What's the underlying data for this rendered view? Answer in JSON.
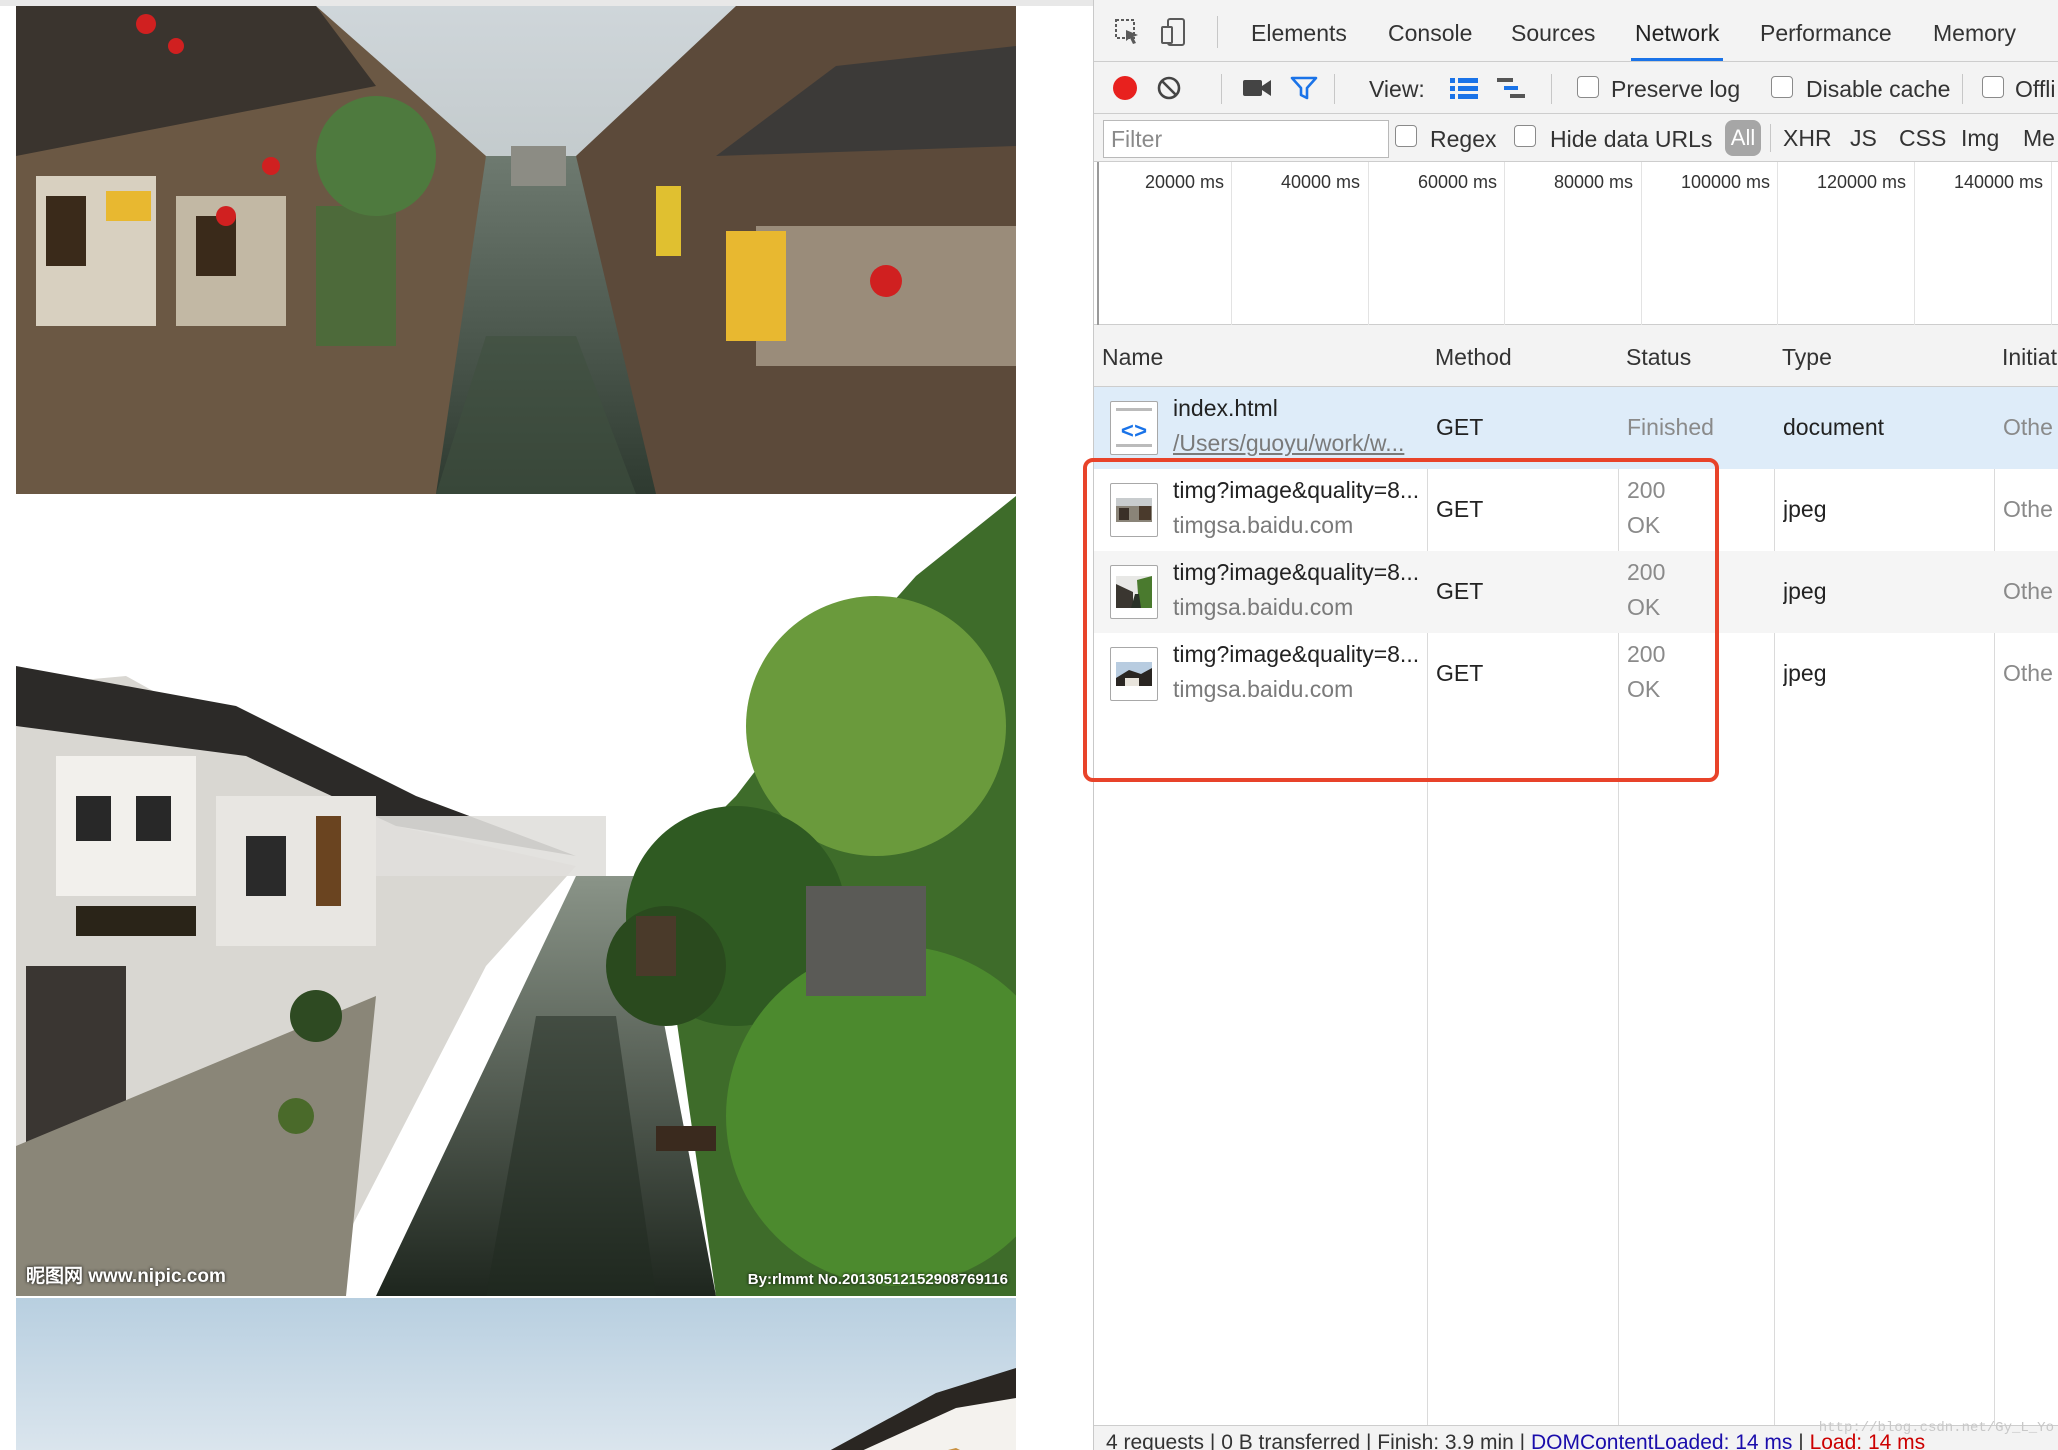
{
  "page": {
    "watermark_left": "昵图网 www.nipic.com",
    "watermark_right": "By:rlmmt No.20130512152908769116"
  },
  "devtools": {
    "tabs": [
      "Elements",
      "Console",
      "Sources",
      "Network",
      "Performance",
      "Memory"
    ],
    "active_tab": "Network",
    "toolbar": {
      "view_label": "View:",
      "preserve_log": "Preserve log",
      "disable_cache": "Disable cache",
      "offline": "Offli"
    },
    "filterbar": {
      "placeholder": "Filter",
      "regex": "Regex",
      "hide_data_urls": "Hide data URLs",
      "all": "All",
      "types": [
        "XHR",
        "JS",
        "CSS",
        "Img",
        "Me"
      ]
    },
    "overview_ticks": [
      "20000 ms",
      "40000 ms",
      "60000 ms",
      "80000 ms",
      "100000 ms",
      "120000 ms",
      "140000 ms"
    ],
    "columns": {
      "name": "Name",
      "method": "Method",
      "status": "Status",
      "type": "Type",
      "initiator": "Initiat"
    },
    "requests": [
      {
        "name": "index.html",
        "sub": "/Users/guoyu/work/w...",
        "method": "GET",
        "status1": "Finished",
        "status2": "",
        "type": "document",
        "initiator": "Othe"
      },
      {
        "name": "timg?image&quality=8...",
        "sub": "timgsa.baidu.com",
        "method": "GET",
        "status1": "200",
        "status2": "OK",
        "type": "jpeg",
        "initiator": "Othe"
      },
      {
        "name": "timg?image&quality=8...",
        "sub": "timgsa.baidu.com",
        "method": "GET",
        "status1": "200",
        "status2": "OK",
        "type": "jpeg",
        "initiator": "Othe"
      },
      {
        "name": "timg?image&quality=8...",
        "sub": "timgsa.baidu.com",
        "method": "GET",
        "status1": "200",
        "status2": "OK",
        "type": "jpeg",
        "initiator": "Othe"
      }
    ],
    "statusbar": {
      "requests": "4 requests",
      "transferred": "0 B transferred",
      "finish": "Finish: 3.9 min",
      "dcl": "DOMContentLoaded: 14 ms",
      "load": "Load: 14 ms"
    },
    "blog_watermark": "http://blog.csdn.net/Gy_L_Yo",
    "colors": {
      "accent": "#1a73e8",
      "record": "#e8211e",
      "highlight": "#e8432a",
      "selected_row": "#deecf9"
    }
  }
}
